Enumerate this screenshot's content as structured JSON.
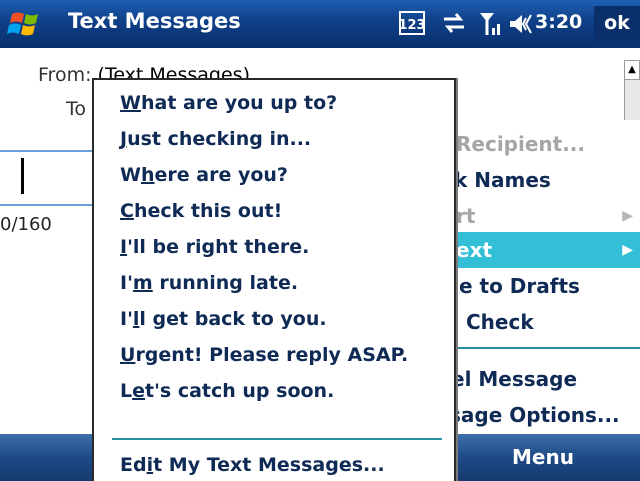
{
  "titlebar": {
    "title": "Text Messages",
    "clock": "3:20",
    "ok_label": "ok",
    "icons": [
      "windows-start-icon",
      "input-123-icon",
      "data-connection-icon",
      "signal-strength-icon",
      "volume-icon"
    ]
  },
  "message": {
    "from_label": "From:",
    "from_value": "(Text Messages)",
    "to_label": "To",
    "char_count": "0/160"
  },
  "main_menu": {
    "items": [
      {
        "label": "Recipient...",
        "state": "disabled"
      },
      {
        "label": "k Names",
        "state": "normal"
      },
      {
        "label": "rt",
        "state": "disabled",
        "has_submenu": true
      },
      {
        "label": "ext",
        "state": "selected",
        "has_submenu": true
      },
      {
        "label": "e to Drafts",
        "state": "normal"
      },
      {
        "label": "Check",
        "state": "normal"
      },
      {
        "label": "el Message",
        "state": "normal"
      },
      {
        "label": "sage Options...",
        "state": "normal"
      }
    ]
  },
  "submenu": {
    "items": [
      {
        "pre": "",
        "key": "W",
        "post": "hat are you up to?"
      },
      {
        "pre": "",
        "key": "J",
        "post": "ust checking in..."
      },
      {
        "pre": "W",
        "key": "h",
        "post": "ere are you?"
      },
      {
        "pre": "",
        "key": "C",
        "post": "heck this out!"
      },
      {
        "pre": "",
        "key": "I",
        "post": "'ll be right there."
      },
      {
        "pre": "I'",
        "key": "m",
        "post": " running late."
      },
      {
        "pre": "I'",
        "key": "l",
        "post": "l get back to you."
      },
      {
        "pre": "",
        "key": "U",
        "post": "rgent! Please reply ASAP."
      },
      {
        "pre": "L",
        "key": "e",
        "post": "t's catch up soon."
      }
    ],
    "edit_item": {
      "pre": "Ed",
      "key": "i",
      "post": "t My Text Messages..."
    }
  },
  "softkeys": {
    "right_label": "Menu"
  },
  "colors": {
    "titlebar": "#0f3f86",
    "menu_text": "#0e2a55",
    "selection": "#33bfd6",
    "separator": "#2a8fa2",
    "disabled_text": "#a5a5a5"
  }
}
